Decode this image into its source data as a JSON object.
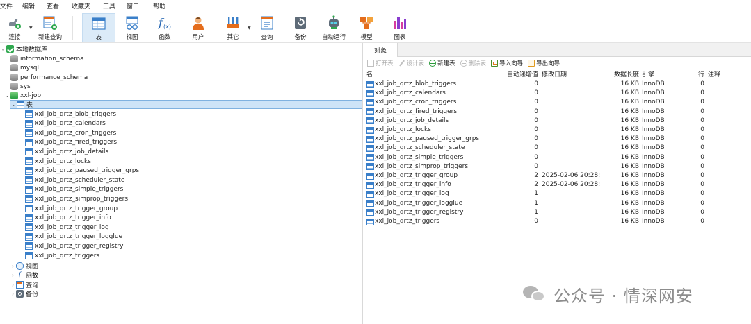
{
  "menubar": [
    "文件",
    "编辑",
    "查看",
    "收藏夹",
    "工具",
    "窗口",
    "帮助"
  ],
  "toolbar": {
    "connect": "连接",
    "new_query": "新建查询",
    "table": "表",
    "view": "视图",
    "function": "函数",
    "user": "用户",
    "other": "其它",
    "query": "查询",
    "backup": "备份",
    "automation": "自动运行",
    "model": "模型",
    "chart": "图表"
  },
  "tree": {
    "connection": "本地数据库",
    "databases": [
      "information_schema",
      "mysql",
      "performance_schema",
      "sys",
      "xxl-job"
    ],
    "tables_group": "表",
    "tables": [
      "xxl_job_qrtz_blob_triggers",
      "xxl_job_qrtz_calendars",
      "xxl_job_qrtz_cron_triggers",
      "xxl_job_qrtz_fired_triggers",
      "xxl_job_qrtz_job_details",
      "xxl_job_qrtz_locks",
      "xxl_job_qrtz_paused_trigger_grps",
      "xxl_job_qrtz_scheduler_state",
      "xxl_job_qrtz_simple_triggers",
      "xxl_job_qrtz_simprop_triggers",
      "xxl_job_qrtz_trigger_group",
      "xxl_job_qrtz_trigger_info",
      "xxl_job_qrtz_trigger_log",
      "xxl_job_qrtz_trigger_logglue",
      "xxl_job_qrtz_trigger_registry",
      "xxl_job_qrtz_triggers"
    ],
    "other_groups": [
      "视图",
      "函数",
      "查询",
      "备份"
    ]
  },
  "right": {
    "tab": "对象",
    "actions": {
      "open_table": "打开表",
      "design_table": "设计表",
      "new_table": "新建表",
      "delete_table": "删除表",
      "import_wizard": "导入向导",
      "export_wizard": "导出向导"
    },
    "columns": {
      "name": "名",
      "auto_inc": "自动递增值",
      "modified": "修改日期",
      "data_length": "数据长度",
      "engine": "引擎",
      "rows": "行",
      "comment": "注释"
    },
    "rows": [
      {
        "name": "xxl_job_qrtz_blob_triggers",
        "auto": "0",
        "date": "",
        "size": "16 KB",
        "engine": "InnoDB",
        "rows": "0"
      },
      {
        "name": "xxl_job_qrtz_calendars",
        "auto": "0",
        "date": "",
        "size": "16 KB",
        "engine": "InnoDB",
        "rows": "0"
      },
      {
        "name": "xxl_job_qrtz_cron_triggers",
        "auto": "0",
        "date": "",
        "size": "16 KB",
        "engine": "InnoDB",
        "rows": "0"
      },
      {
        "name": "xxl_job_qrtz_fired_triggers",
        "auto": "0",
        "date": "",
        "size": "16 KB",
        "engine": "InnoDB",
        "rows": "0"
      },
      {
        "name": "xxl_job_qrtz_job_details",
        "auto": "0",
        "date": "",
        "size": "16 KB",
        "engine": "InnoDB",
        "rows": "0"
      },
      {
        "name": "xxl_job_qrtz_locks",
        "auto": "0",
        "date": "",
        "size": "16 KB",
        "engine": "InnoDB",
        "rows": "0"
      },
      {
        "name": "xxl_job_qrtz_paused_trigger_grps",
        "auto": "0",
        "date": "",
        "size": "16 KB",
        "engine": "InnoDB",
        "rows": "0"
      },
      {
        "name": "xxl_job_qrtz_scheduler_state",
        "auto": "0",
        "date": "",
        "size": "16 KB",
        "engine": "InnoDB",
        "rows": "0"
      },
      {
        "name": "xxl_job_qrtz_simple_triggers",
        "auto": "0",
        "date": "",
        "size": "16 KB",
        "engine": "InnoDB",
        "rows": "0"
      },
      {
        "name": "xxl_job_qrtz_simprop_triggers",
        "auto": "0",
        "date": "",
        "size": "16 KB",
        "engine": "InnoDB",
        "rows": "0"
      },
      {
        "name": "xxl_job_qrtz_trigger_group",
        "auto": "2",
        "date": "2025-02-06 20:28:...",
        "size": "16 KB",
        "engine": "InnoDB",
        "rows": "0"
      },
      {
        "name": "xxl_job_qrtz_trigger_info",
        "auto": "2",
        "date": "2025-02-06 20:28:...",
        "size": "16 KB",
        "engine": "InnoDB",
        "rows": "0"
      },
      {
        "name": "xxl_job_qrtz_trigger_log",
        "auto": "1",
        "date": "",
        "size": "16 KB",
        "engine": "InnoDB",
        "rows": "0"
      },
      {
        "name": "xxl_job_qrtz_trigger_logglue",
        "auto": "1",
        "date": "",
        "size": "16 KB",
        "engine": "InnoDB",
        "rows": "0"
      },
      {
        "name": "xxl_job_qrtz_trigger_registry",
        "auto": "1",
        "date": "",
        "size": "16 KB",
        "engine": "InnoDB",
        "rows": "0"
      },
      {
        "name": "xxl_job_qrtz_triggers",
        "auto": "0",
        "date": "",
        "size": "16 KB",
        "engine": "InnoDB",
        "rows": "0"
      }
    ]
  },
  "watermark": "公众号 · 情深网安"
}
